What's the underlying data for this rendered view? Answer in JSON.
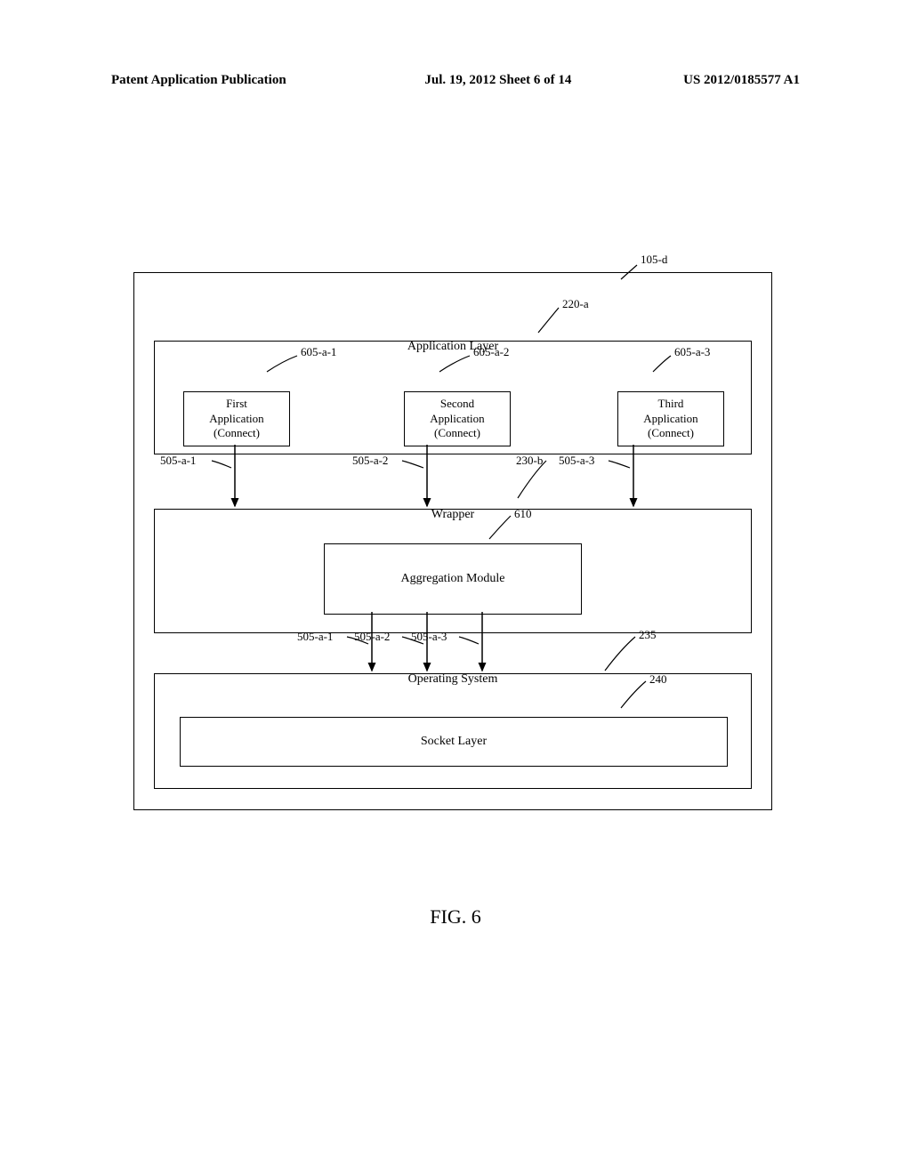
{
  "header": {
    "left": "Patent Application Publication",
    "center": "Jul. 19, 2012  Sheet 6 of 14",
    "right": "US 2012/0185577 A1"
  },
  "diagram": {
    "outer_ref": "105-d",
    "app_layer": {
      "title": "Application Layer",
      "ref": "220-a",
      "apps": [
        {
          "line1": "First",
          "line2": "Application",
          "line3": "(Connect)",
          "ref": "605-a-1"
        },
        {
          "line1": "Second",
          "line2": "Application",
          "line3": "(Connect)",
          "ref": "605-a-2"
        },
        {
          "line1": "Third",
          "line2": "Application",
          "line3": "(Connect)",
          "ref": "605-a-3"
        }
      ]
    },
    "arrow_refs_top": [
      "505-a-1",
      "505-a-2",
      "505-a-3"
    ],
    "wrapper": {
      "title": "Wrapper",
      "ref": "230-b",
      "aggregation": {
        "title": "Aggregation Module",
        "ref": "610"
      }
    },
    "arrow_refs_bottom": [
      "505-a-1",
      "505-a-2",
      "505-a-3"
    ],
    "os": {
      "title": "Operating System",
      "ref": "235",
      "socket": {
        "title": "Socket Layer",
        "ref": "240"
      }
    }
  },
  "figure_caption": "FIG. 6"
}
